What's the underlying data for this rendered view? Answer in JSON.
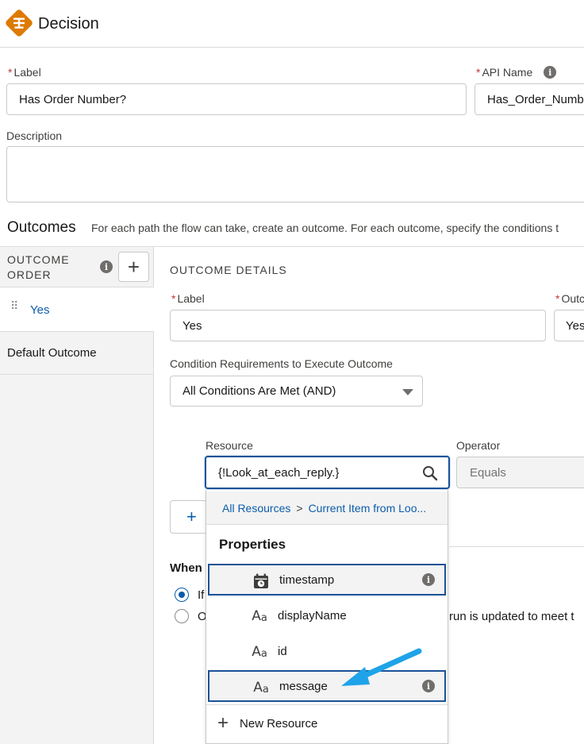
{
  "header": {
    "title": "Decision",
    "icon": "decision-icon",
    "icon_color": "#dd7a01"
  },
  "form": {
    "label_label": "Label",
    "label_value": "Has Order Number?",
    "api_name_label": "API Name",
    "api_name_value": "Has_Order_Numb",
    "description_label": "Description",
    "description_value": ""
  },
  "outcomes": {
    "title": "Outcomes",
    "description": "For each path the flow can take, create an outcome. For each outcome, specify the conditions t",
    "order_header_line1": "OUTCOME",
    "order_header_line2": "ORDER",
    "add_icon": "plus-icon",
    "items": [
      {
        "label": "Yes"
      },
      {
        "label": "Default Outcome"
      }
    ]
  },
  "details": {
    "title": "OUTCOME DETAILS",
    "label_label": "Label",
    "label_value": "Yes",
    "outcome_api_label": "Outc",
    "outcome_api_value": "Yes",
    "condition_req_label": "Condition Requirements to Execute Outcome",
    "condition_req_value": "All Conditions Are Met (AND)",
    "resource_label": "Resource",
    "resource_value": "{!Look_at_each_reply.}",
    "operator_label": "Operator",
    "operator_value": "Equals",
    "when_label": "When",
    "radio1_text": "If",
    "radio2_text": "O",
    "radio2_trailing": "run is updated to meet t"
  },
  "dropdown": {
    "crumb_root": "All Resources",
    "crumb_sep": ">",
    "crumb_current": "Current Item from Loo...",
    "section_title": "Properties",
    "items": [
      {
        "label": "timestamp",
        "icon": "datetime-icon",
        "highlighted": true,
        "info": true
      },
      {
        "label": "displayName",
        "icon": "text-icon",
        "highlighted": false,
        "info": false
      },
      {
        "label": "id",
        "icon": "text-icon",
        "highlighted": false,
        "info": false
      },
      {
        "label": "message",
        "icon": "text-icon",
        "highlighted": true,
        "info": true
      }
    ],
    "new_resource": "New Resource"
  },
  "annotation": {
    "arrow_color": "#1fa3e8"
  },
  "colors": {
    "brand_blue": "#0b5cab",
    "focus_border": "#1b5297",
    "required": "#c23934"
  }
}
